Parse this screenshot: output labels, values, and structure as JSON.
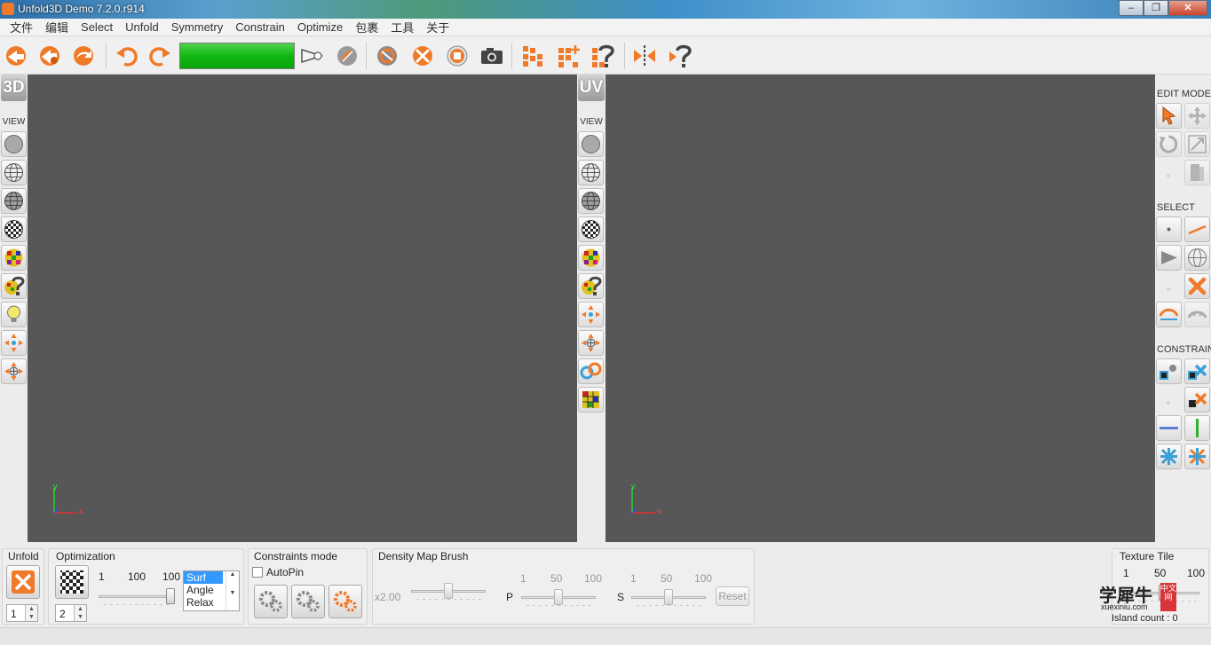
{
  "window": {
    "title": "Unfold3D Demo 7.2.0.r914",
    "min": "–",
    "max": "❐",
    "close": "✕"
  },
  "menu": [
    "文件",
    "编辑",
    "Select",
    "Unfold",
    "Symmetry",
    "Constrain",
    "Optimize",
    "包裹",
    "工具",
    "关于"
  ],
  "toolbar": {
    "progress": 1.0
  },
  "left_bar": {
    "mode_label": "3D",
    "view_label": "VIEW"
  },
  "mid_bar": {
    "mode_label": "UV",
    "view_label": "VIEW"
  },
  "viewport_left": {
    "axis_x": "x",
    "axis_y": "y"
  },
  "viewport_right": {
    "axis_x": "u",
    "axis_y": "v"
  },
  "right_panel": {
    "edit_mode": "EDIT MODE",
    "select": "SELECT",
    "constrain": "CONSTRAIN"
  },
  "bottom": {
    "unfold": {
      "label": "Unfold",
      "value": "1"
    },
    "optimization": {
      "label": "Optimization",
      "value": "2",
      "ticks": [
        "1",
        "100",
        "100"
      ],
      "options": [
        "Surf",
        "Angle",
        "Relax"
      ],
      "selected": "Surf",
      "slider": 1.0
    },
    "constraints": {
      "label": "Constraints mode",
      "autopin": "AutoPin"
    },
    "density": {
      "label": "Density Map Brush",
      "multiplier": "x2.00",
      "p_label": "P",
      "s_label": "S",
      "p_ticks": [
        "1",
        "50",
        "100"
      ],
      "s_ticks": [
        "1",
        "50",
        "100"
      ],
      "reset": "Reset",
      "brush_slider": 0.5,
      "p_slider": 0.5,
      "s_slider": 0.5
    },
    "texture_tile": {
      "label": "Texture Tile",
      "ticks": [
        "1",
        "50",
        "100"
      ]
    },
    "island_count": "Island count : 0"
  },
  "watermark": {
    "main": "学犀牛",
    "sub": "xuexiniu.com",
    "box": "中文网"
  },
  "colors": {
    "accent": "#f07a2a",
    "viewport": "#575757",
    "progress": "#10b710",
    "selection": "#3399ff"
  }
}
